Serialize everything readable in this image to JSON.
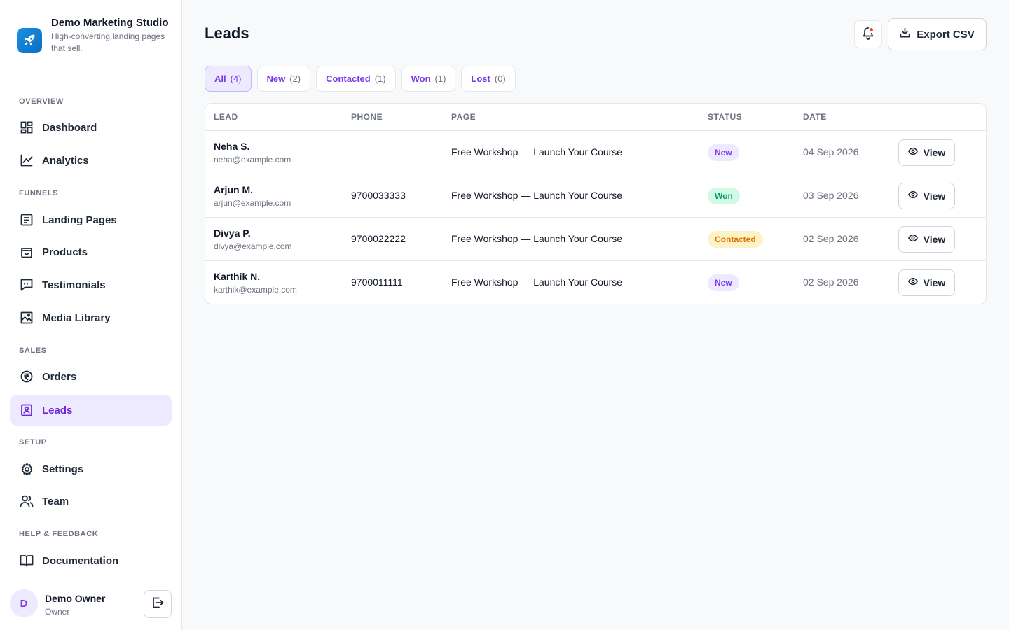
{
  "brand": {
    "name": "Demo Marketing Studio",
    "tagline": "High-converting landing pages that sell."
  },
  "sidebar": {
    "sections": [
      {
        "label": "OVERVIEW",
        "items": [
          {
            "label": "Dashboard",
            "icon": "dashboard-icon"
          },
          {
            "label": "Analytics",
            "icon": "chart-line-icon"
          }
        ]
      },
      {
        "label": "FUNNELS",
        "items": [
          {
            "label": "Landing Pages",
            "icon": "page-layout-icon"
          },
          {
            "label": "Products",
            "icon": "shopping-bag-icon"
          },
          {
            "label": "Testimonials",
            "icon": "quote-bubble-icon"
          },
          {
            "label": "Media Library",
            "icon": "image-icon"
          }
        ]
      },
      {
        "label": "SALES",
        "items": [
          {
            "label": "Orders",
            "icon": "rupee-circle-icon"
          },
          {
            "label": "Leads",
            "icon": "contact-book-icon",
            "active": true
          }
        ]
      },
      {
        "label": "SETUP",
        "items": [
          {
            "label": "Settings",
            "icon": "gear-icon"
          },
          {
            "label": "Team",
            "icon": "users-icon"
          }
        ]
      },
      {
        "label": "HELP & FEEDBACK",
        "items": [
          {
            "label": "Documentation",
            "icon": "book-open-icon"
          }
        ]
      }
    ]
  },
  "user": {
    "initial": "D",
    "name": "Demo Owner",
    "role": "Owner"
  },
  "header": {
    "title": "Leads",
    "export_label": "Export CSV"
  },
  "filters": [
    {
      "label": "All",
      "count": "(4)",
      "active": true
    },
    {
      "label": "New",
      "count": "(2)"
    },
    {
      "label": "Contacted",
      "count": "(1)"
    },
    {
      "label": "Won",
      "count": "(1)"
    },
    {
      "label": "Lost",
      "count": "(0)"
    }
  ],
  "table": {
    "columns": [
      "LEAD",
      "PHONE",
      "PAGE",
      "STATUS",
      "DATE"
    ],
    "view_label": "View",
    "rows": [
      {
        "name": "Neha S.",
        "email": "neha@example.com",
        "phone": "—",
        "page": "Free Workshop — Launch Your Course",
        "status": "New",
        "date": "04 Sep 2026"
      },
      {
        "name": "Arjun M.",
        "email": "arjun@example.com",
        "phone": "9700033333",
        "page": "Free Workshop — Launch Your Course",
        "status": "Won",
        "date": "03 Sep 2026"
      },
      {
        "name": "Divya P.",
        "email": "divya@example.com",
        "phone": "9700022222",
        "page": "Free Workshop — Launch Your Course",
        "status": "Contacted",
        "date": "02 Sep 2026"
      },
      {
        "name": "Karthik N.",
        "email": "karthik@example.com",
        "phone": "9700011111",
        "page": "Free Workshop — Launch Your Course",
        "status": "New",
        "date": "02 Sep 2026"
      }
    ]
  },
  "colors": {
    "accent": "#7c3aed",
    "status_new_bg": "#ede9fe",
    "status_new_fg": "#7c3aed",
    "status_won_bg": "#d1fae5",
    "status_won_fg": "#059669",
    "status_contacted_bg": "#fef3c7",
    "status_contacted_fg": "#d97706",
    "status_lost_bg": "#fee2e2",
    "status_lost_fg": "#dc2626"
  }
}
